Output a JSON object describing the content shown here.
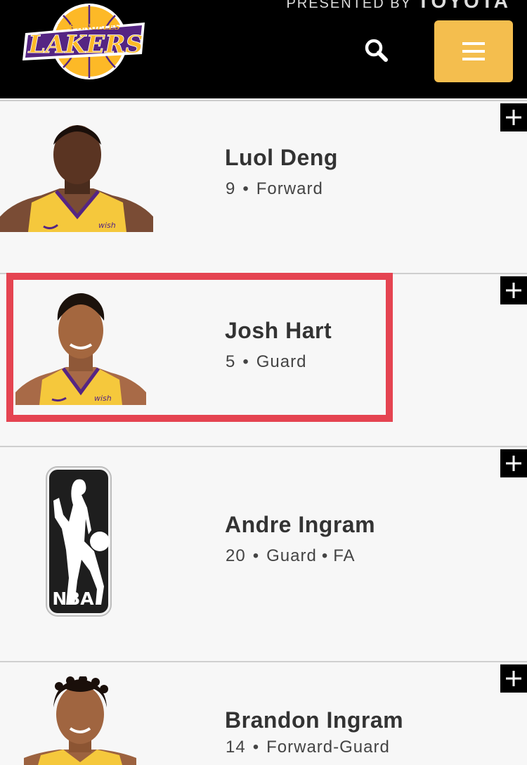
{
  "header": {
    "presented_by": "PRESENTED BY",
    "presented_brand": "TOYOTA",
    "logo_top_text": "LOS ANGELES",
    "logo_main_text": "LAKERS",
    "colors": {
      "background": "#000000",
      "menu_button": "#f4be4e",
      "logo_purple": "#552583",
      "logo_gold": "#fdb927"
    }
  },
  "icons": {
    "search": "search-icon",
    "menu": "hamburger-menu-icon",
    "expand": "plus-icon"
  },
  "players": [
    {
      "name": "Luol Deng",
      "number": "9",
      "position": "Forward",
      "status": "",
      "photo": "player-photo"
    },
    {
      "name": "Josh Hart",
      "number": "5",
      "position": "Guard",
      "status": "",
      "photo": "player-photo"
    },
    {
      "name": "Andre Ingram",
      "number": "20",
      "position": "Guard",
      "status": "FA",
      "photo": "nba-logo"
    },
    {
      "name": "Brandon Ingram",
      "number": "14",
      "position": "Forward-Guard",
      "status": "",
      "photo": "player-photo"
    }
  ],
  "jersey_sponsor": "wish",
  "nba_logo_text": "NBA",
  "highlight_color": "#e54451"
}
